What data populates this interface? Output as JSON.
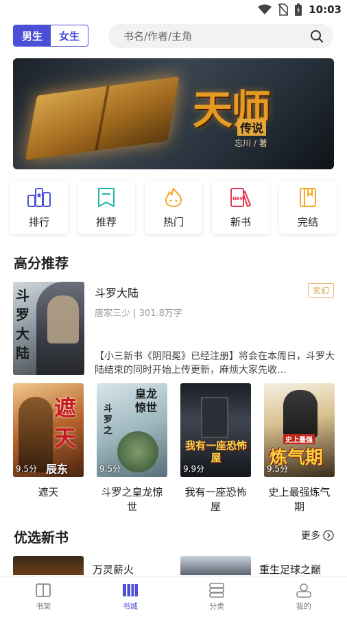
{
  "status": {
    "time": "10:03"
  },
  "gender": {
    "male": "男生",
    "female": "女生"
  },
  "search": {
    "placeholder": "书名/作者/主角"
  },
  "banner": {
    "title": "天师",
    "subtitle": "传说",
    "author": "忘川 / 著"
  },
  "categories": [
    {
      "label": "排行",
      "icon": "ranking-icon",
      "color": "#4a4fd6"
    },
    {
      "label": "推荐",
      "icon": "bookmark-icon",
      "color": "#1fb7a6"
    },
    {
      "label": "热门",
      "icon": "flame-icon",
      "color": "#f5a623"
    },
    {
      "label": "新书",
      "icon": "new-book-icon",
      "color": "#e8344f"
    },
    {
      "label": "完结",
      "icon": "finished-book-icon",
      "color": "#f5a623"
    }
  ],
  "sections": {
    "high_score": "高分推荐",
    "new_books": "优选新书",
    "more": "更多"
  },
  "featured": {
    "title": "斗罗大陆",
    "genre": "玄幻",
    "meta": "唐家三少 | 301.8万字",
    "description": "【小三新书《阴阳冕》已经注册】将会在本周日，斗罗大陆结束的同时开始上传更新，麻烦大家先收…",
    "cover_text": "斗罗大陆"
  },
  "books": [
    {
      "title": "遮天",
      "score": "9.5分",
      "cover_text": "遮天",
      "cover_author": "辰东"
    },
    {
      "title": "斗罗之皇龙惊世",
      "score": "9.5分",
      "cover_text": "皇龙惊世",
      "cover_sub": "斗罗之"
    },
    {
      "title": "我有一座恐怖屋",
      "score": "9.9分",
      "cover_text": "我有一座恐怖屋"
    },
    {
      "title": "史上最强炼气期",
      "score": "9.5分",
      "cover_text": "炼气期",
      "cover_sub": "史上最强"
    }
  ],
  "new_books": [
    {
      "title": "万灵薪火"
    },
    {
      "title": "重生足球之巅"
    }
  ],
  "nav": [
    {
      "label": "书架",
      "icon": "bookshelf-icon"
    },
    {
      "label": "书城",
      "icon": "bookstore-icon",
      "active": true
    },
    {
      "label": "分类",
      "icon": "category-icon"
    },
    {
      "label": "我的",
      "icon": "profile-icon"
    }
  ],
  "colors": {
    "accent": "#4a4fd6",
    "genre_tag": "#d99a3a"
  }
}
